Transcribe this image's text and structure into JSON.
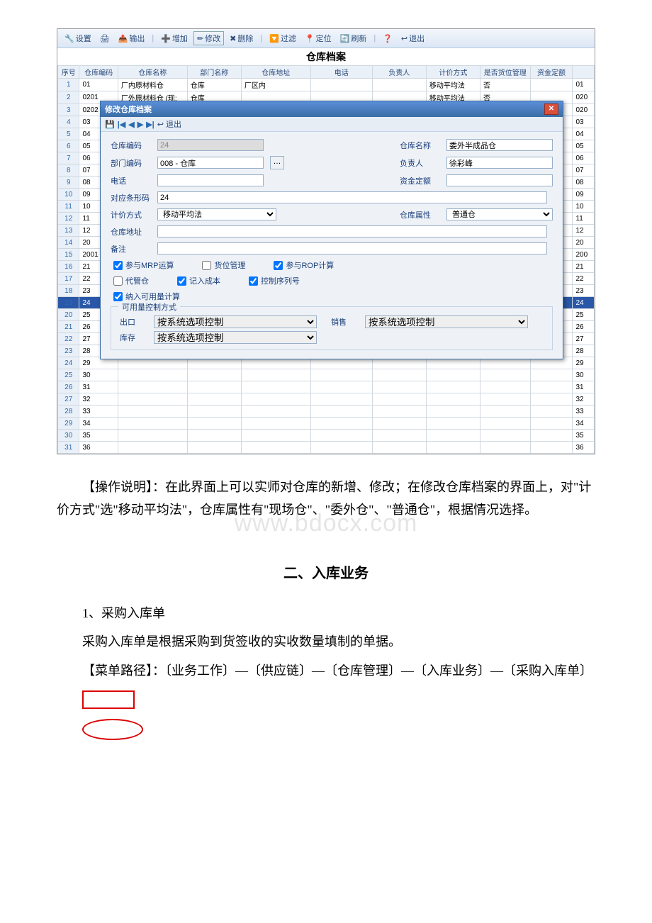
{
  "toolbar": {
    "settings": "设置",
    "output": "输出",
    "add": "增加",
    "modify": "修改",
    "delete": "删除",
    "filter": "过滤",
    "locate": "定位",
    "refresh": "刷新",
    "exit": "退出"
  },
  "page_title": "仓库档案",
  "columns": {
    "seq": "序号",
    "code": "仓库编码",
    "name": "仓库名称",
    "dept": "部门名称",
    "addr": "仓库地址",
    "tel": "电话",
    "resp": "负责人",
    "method": "计价方式",
    "loc_mgmt": "是否货位管理",
    "fund": "资金定额"
  },
  "rows": [
    {
      "seq": "1",
      "code": "01",
      "name": "厂内原材料仓",
      "dept": "仓库",
      "addr": "厂区内",
      "tel": "",
      "resp": "",
      "method": "移动平均法",
      "loc": "否",
      "fund": "",
      "last": "01"
    },
    {
      "seq": "2",
      "code": "0201",
      "name": "厂外原材料仓 (现:",
      "dept": "仓库",
      "addr": "",
      "tel": "",
      "resp": "",
      "method": "移动平均法",
      "loc": "否",
      "fund": "",
      "last": "020"
    },
    {
      "seq": "3",
      "code": "0202",
      "name": "",
      "dept": "",
      "addr": "",
      "tel": "",
      "resp": "",
      "method": "",
      "loc": "",
      "fund": "",
      "last": "020"
    },
    {
      "seq": "4",
      "code": "03",
      "name": "",
      "dept": "",
      "addr": "",
      "tel": "",
      "resp": "",
      "method": "",
      "loc": "",
      "fund": "",
      "last": "03"
    },
    {
      "seq": "5",
      "code": "04",
      "name": "",
      "dept": "",
      "addr": "",
      "tel": "",
      "resp": "",
      "method": "",
      "loc": "",
      "fund": "",
      "last": "04"
    },
    {
      "seq": "6",
      "code": "05",
      "name": "",
      "dept": "",
      "addr": "",
      "tel": "",
      "resp": "",
      "method": "",
      "loc": "",
      "fund": "",
      "last": "05"
    },
    {
      "seq": "7",
      "code": "06",
      "name": "",
      "dept": "",
      "addr": "",
      "tel": "",
      "resp": "",
      "method": "",
      "loc": "",
      "fund": "",
      "last": "06"
    },
    {
      "seq": "8",
      "code": "07",
      "name": "",
      "dept": "",
      "addr": "",
      "tel": "",
      "resp": "",
      "method": "",
      "loc": "",
      "fund": "",
      "last": "07"
    },
    {
      "seq": "9",
      "code": "08",
      "name": "",
      "dept": "",
      "addr": "",
      "tel": "",
      "resp": "",
      "method": "",
      "loc": "",
      "fund": "",
      "last": "08"
    },
    {
      "seq": "10",
      "code": "09",
      "name": "",
      "dept": "",
      "addr": "",
      "tel": "",
      "resp": "",
      "method": "",
      "loc": "",
      "fund": "",
      "last": "09"
    },
    {
      "seq": "11",
      "code": "10",
      "name": "",
      "dept": "",
      "addr": "",
      "tel": "",
      "resp": "",
      "method": "",
      "loc": "",
      "fund": "",
      "last": "10"
    },
    {
      "seq": "12",
      "code": "11",
      "name": "",
      "dept": "",
      "addr": "",
      "tel": "",
      "resp": "",
      "method": "",
      "loc": "",
      "fund": "",
      "last": "11"
    },
    {
      "seq": "13",
      "code": "12",
      "name": "",
      "dept": "",
      "addr": "",
      "tel": "",
      "resp": "",
      "method": "",
      "loc": "",
      "fund": "",
      "last": "12"
    },
    {
      "seq": "14",
      "code": "20",
      "name": "",
      "dept": "",
      "addr": "",
      "tel": "",
      "resp": "",
      "method": "",
      "loc": "",
      "fund": "",
      "last": "20"
    },
    {
      "seq": "15",
      "code": "2001",
      "name": "",
      "dept": "",
      "addr": "",
      "tel": "",
      "resp": "",
      "method": "",
      "loc": "",
      "fund": "",
      "last": "200"
    },
    {
      "seq": "16",
      "code": "21",
      "name": "",
      "dept": "",
      "addr": "",
      "tel": "",
      "resp": "",
      "method": "",
      "loc": "",
      "fund": "",
      "last": "21"
    },
    {
      "seq": "17",
      "code": "22",
      "name": "",
      "dept": "",
      "addr": "",
      "tel": "",
      "resp": "",
      "method": "",
      "loc": "",
      "fund": "",
      "last": "22"
    },
    {
      "seq": "18",
      "code": "23",
      "name": "",
      "dept": "",
      "addr": "",
      "tel": "",
      "resp": "",
      "method": "",
      "loc": "",
      "fund": "",
      "last": "23"
    },
    {
      "seq": "19",
      "code": "24",
      "name": "",
      "dept": "",
      "addr": "",
      "tel": "",
      "resp": "",
      "method": "",
      "loc": "",
      "fund": "",
      "last": "24",
      "highlight": true
    },
    {
      "seq": "20",
      "code": "25",
      "name": "",
      "dept": "",
      "addr": "",
      "tel": "",
      "resp": "",
      "method": "",
      "loc": "",
      "fund": "",
      "last": "25"
    },
    {
      "seq": "21",
      "code": "26",
      "name": "",
      "dept": "",
      "addr": "",
      "tel": "",
      "resp": "",
      "method": "",
      "loc": "",
      "fund": "",
      "last": "26"
    },
    {
      "seq": "22",
      "code": "27",
      "name": "",
      "dept": "",
      "addr": "",
      "tel": "",
      "resp": "",
      "method": "",
      "loc": "",
      "fund": "",
      "last": "27"
    },
    {
      "seq": "23",
      "code": "28",
      "name": "",
      "dept": "",
      "addr": "",
      "tel": "",
      "resp": "",
      "method": "",
      "loc": "",
      "fund": "",
      "last": "28"
    },
    {
      "seq": "24",
      "code": "29",
      "name": "",
      "dept": "",
      "addr": "",
      "tel": "",
      "resp": "",
      "method": "",
      "loc": "",
      "fund": "",
      "last": "29"
    },
    {
      "seq": "25",
      "code": "30",
      "name": "",
      "dept": "",
      "addr": "",
      "tel": "",
      "resp": "",
      "method": "",
      "loc": "",
      "fund": "",
      "last": "30"
    },
    {
      "seq": "26",
      "code": "31",
      "name": "",
      "dept": "",
      "addr": "",
      "tel": "",
      "resp": "",
      "method": "",
      "loc": "",
      "fund": "",
      "last": "31"
    },
    {
      "seq": "27",
      "code": "32",
      "name": "",
      "dept": "",
      "addr": "",
      "tel": "",
      "resp": "",
      "method": "",
      "loc": "",
      "fund": "",
      "last": "32"
    },
    {
      "seq": "28",
      "code": "33",
      "name": "",
      "dept": "",
      "addr": "",
      "tel": "",
      "resp": "",
      "method": "",
      "loc": "",
      "fund": "",
      "last": "33"
    },
    {
      "seq": "29",
      "code": "34",
      "name": "",
      "dept": "",
      "addr": "",
      "tel": "",
      "resp": "",
      "method": "",
      "loc": "",
      "fund": "",
      "last": "34"
    },
    {
      "seq": "30",
      "code": "35",
      "name": "",
      "dept": "",
      "addr": "",
      "tel": "",
      "resp": "",
      "method": "",
      "loc": "",
      "fund": "",
      "last": "35"
    },
    {
      "seq": "31",
      "code": "36",
      "name": "",
      "dept": "",
      "addr": "",
      "tel": "",
      "resp": "",
      "method": "",
      "loc": "",
      "fund": "",
      "last": "36"
    }
  ],
  "dialog": {
    "title": "修改仓库档案",
    "toolbar": {
      "exit": "退出"
    },
    "labels": {
      "code": "仓库编码",
      "name": "仓库名称",
      "dept": "部门编码",
      "resp": "负责人",
      "phone": "电话",
      "fund": "资金定额",
      "barcode": "对应条形码",
      "method": "计价方式",
      "attr": "仓库属性",
      "addr": "仓库地址",
      "remark": "备注"
    },
    "values": {
      "code": "24",
      "name": "委外半成品仓",
      "dept": "008 - 仓库",
      "resp": "徐彩峰",
      "phone": "",
      "fund": "",
      "barcode": "24",
      "method": "移动平均法",
      "attr": "普通仓",
      "addr": "",
      "remark": ""
    },
    "checkboxes": {
      "mrp": "参与MRP运算",
      "loc_mgmt": "货位管理",
      "rop": "参与ROP计算",
      "proxy": "代管仓",
      "in_cost": "记入成本",
      "ctrl_sn": "控制序列号",
      "avail_calc": "纳入可用量计算"
    },
    "group": {
      "legend": "可用量控制方式",
      "export": "出口",
      "sale": "销售",
      "stock": "库存",
      "option_sys": "按系统选项控制"
    }
  },
  "doc": {
    "p1": "【操作说明】：在此界面上可以实师对仓库的新增、修改；在修改仓库档案的界面上，对\"计价方式\"选\"移动平均法\"，仓库属性有\"现场仓\"、\"委外仓\"、\"普通仓\"，根据情况选择。",
    "watermark": "www.bdocx.com",
    "h2": "二、入库业务",
    "p2": "1、采购入库单",
    "p3": "采购入库单是根据采购到货签收的实收数量填制的单据。",
    "p4": "【菜单路径】：〔业务工作〕—〔供应链〕—〔仓库管理〕—〔入库业务〕—〔采购入库单〕"
  }
}
